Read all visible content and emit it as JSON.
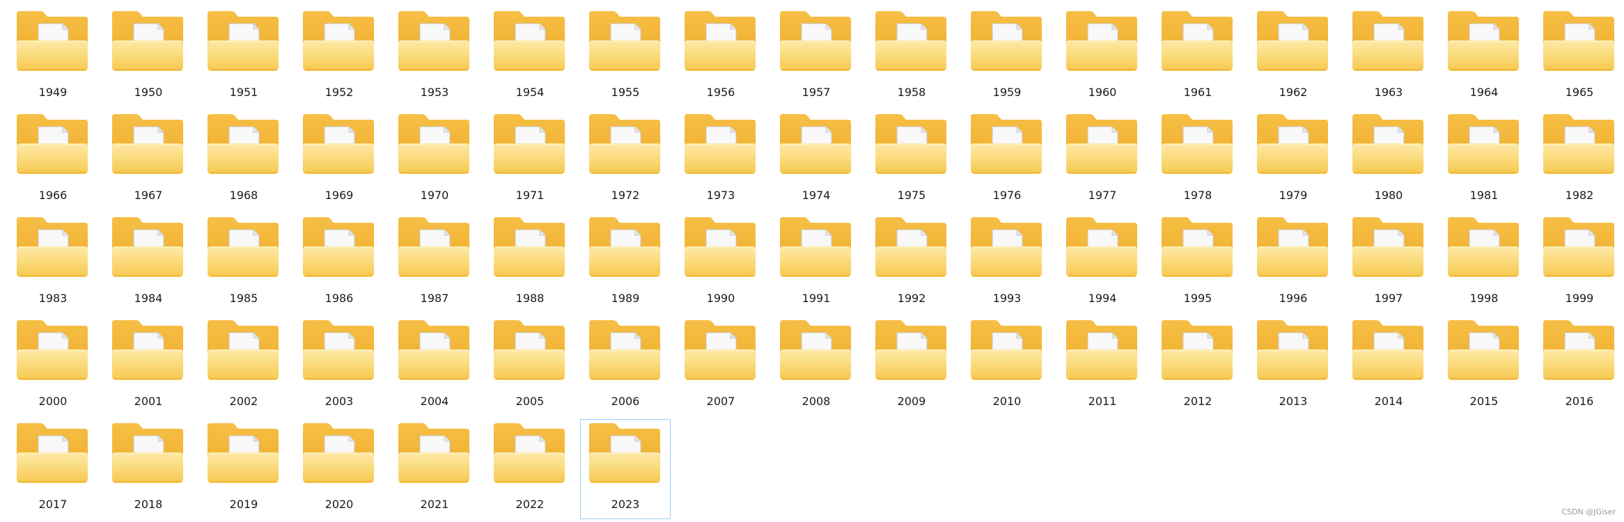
{
  "colors": {
    "folder_back": "#f4b73a",
    "folder_front_top": "#fce597",
    "folder_front_bottom": "#f8cc55",
    "paper": "#f7f7f7",
    "selection_border": "#99d1f5"
  },
  "icon_name": "folder-icon",
  "folders": [
    {
      "label": "1949"
    },
    {
      "label": "1950"
    },
    {
      "label": "1951"
    },
    {
      "label": "1952"
    },
    {
      "label": "1953"
    },
    {
      "label": "1954"
    },
    {
      "label": "1955"
    },
    {
      "label": "1956"
    },
    {
      "label": "1957"
    },
    {
      "label": "1958"
    },
    {
      "label": "1959"
    },
    {
      "label": "1960"
    },
    {
      "label": "1961"
    },
    {
      "label": "1962"
    },
    {
      "label": "1963"
    },
    {
      "label": "1964"
    },
    {
      "label": "1965"
    },
    {
      "label": "1966"
    },
    {
      "label": "1967"
    },
    {
      "label": "1968"
    },
    {
      "label": "1969"
    },
    {
      "label": "1970"
    },
    {
      "label": "1971"
    },
    {
      "label": "1972"
    },
    {
      "label": "1973"
    },
    {
      "label": "1974"
    },
    {
      "label": "1975"
    },
    {
      "label": "1976"
    },
    {
      "label": "1977"
    },
    {
      "label": "1978"
    },
    {
      "label": "1979"
    },
    {
      "label": "1980"
    },
    {
      "label": "1981"
    },
    {
      "label": "1982"
    },
    {
      "label": "1983"
    },
    {
      "label": "1984"
    },
    {
      "label": "1985"
    },
    {
      "label": "1986"
    },
    {
      "label": "1987"
    },
    {
      "label": "1988"
    },
    {
      "label": "1989"
    },
    {
      "label": "1990"
    },
    {
      "label": "1991"
    },
    {
      "label": "1992"
    },
    {
      "label": "1993"
    },
    {
      "label": "1994"
    },
    {
      "label": "1995"
    },
    {
      "label": "1996"
    },
    {
      "label": "1997"
    },
    {
      "label": "1998"
    },
    {
      "label": "1999"
    },
    {
      "label": "2000"
    },
    {
      "label": "2001"
    },
    {
      "label": "2002"
    },
    {
      "label": "2003"
    },
    {
      "label": "2004"
    },
    {
      "label": "2005"
    },
    {
      "label": "2006"
    },
    {
      "label": "2007"
    },
    {
      "label": "2008"
    },
    {
      "label": "2009"
    },
    {
      "label": "2010"
    },
    {
      "label": "2011"
    },
    {
      "label": "2012"
    },
    {
      "label": "2013"
    },
    {
      "label": "2014"
    },
    {
      "label": "2015"
    },
    {
      "label": "2016"
    },
    {
      "label": "2017"
    },
    {
      "label": "2018"
    },
    {
      "label": "2019"
    },
    {
      "label": "2020"
    },
    {
      "label": "2021"
    },
    {
      "label": "2022"
    },
    {
      "label": "2023",
      "selected": true
    }
  ],
  "watermark": "CSDN @JGiser"
}
